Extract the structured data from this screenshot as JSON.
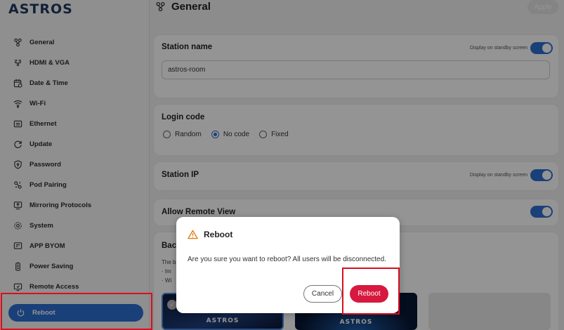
{
  "app": {
    "logo": "ASTROS"
  },
  "sidebar": {
    "items": [
      {
        "label": "General",
        "icon": "people-network-icon"
      },
      {
        "label": "HDMI & VGA",
        "icon": "hdmi-icon"
      },
      {
        "label": "Date & Time",
        "icon": "calendar-icon"
      },
      {
        "label": "Wi-Fi",
        "icon": "wifi-icon"
      },
      {
        "label": "Ethernet",
        "icon": "ethernet-icon"
      },
      {
        "label": "Update",
        "icon": "refresh-icon"
      },
      {
        "label": "Password",
        "icon": "shield-icon"
      },
      {
        "label": "Pod Pairing",
        "icon": "pairing-icon"
      },
      {
        "label": "Mirroring Protocols",
        "icon": "mirroring-icon"
      },
      {
        "label": "System",
        "icon": "gear-icon"
      },
      {
        "label": "APP BYOM",
        "icon": "app-icon"
      },
      {
        "label": "Power Saving",
        "icon": "battery-icon"
      },
      {
        "label": "Remote Access",
        "icon": "remote-icon"
      },
      {
        "label": "Reboot",
        "icon": "power-icon",
        "active": true
      }
    ]
  },
  "header": {
    "title": "General",
    "apply_label": "Apply"
  },
  "station_name": {
    "title": "Station name",
    "standby_label": "Display on standby screen",
    "value": "astros-room"
  },
  "login_code": {
    "title": "Login code",
    "options": [
      "Random",
      "No code",
      "Fixed"
    ],
    "selected": "No code"
  },
  "station_ip": {
    "title": "Station IP",
    "standby_label": "Display on standby screen"
  },
  "remote_view": {
    "title": "Allow Remote View"
  },
  "background": {
    "title_partial": "Bac",
    "line1_partial": "The b",
    "line2_partial": "· Im",
    "line3_partial": "· Wi",
    "thumb_brand": "ASTROS"
  },
  "dialog": {
    "title": "Reboot",
    "message": "Are you sure you want to reboot? All users will be disconnected.",
    "cancel_label": "Cancel",
    "confirm_label": "Reboot"
  },
  "colors": {
    "accent": "#2d6fd1",
    "danger": "#d7193f",
    "highlight": "#d90f1e",
    "warning": "#e07a10"
  }
}
